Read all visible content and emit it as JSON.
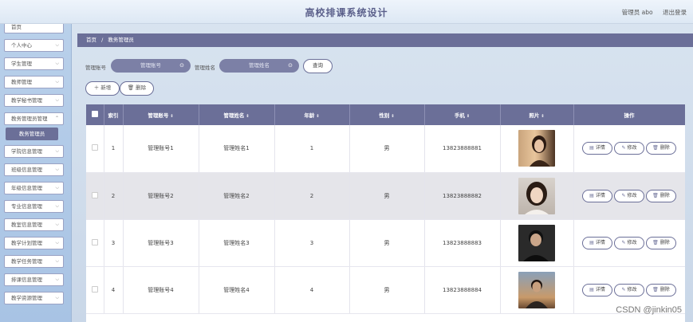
{
  "header": {
    "title": "高校排课系统设计",
    "user_label": "管理员 abo",
    "logout_label": "退出登录"
  },
  "sidebar": {
    "items": [
      {
        "label": "首页"
      },
      {
        "label": "个人中心"
      },
      {
        "label": "学生管理"
      },
      {
        "label": "教师管理"
      },
      {
        "label": "教学秘书管理"
      },
      {
        "label": "教务管理员管理"
      },
      {
        "label": "学院信息管理"
      },
      {
        "label": "班级信息管理"
      },
      {
        "label": "年级信息管理"
      },
      {
        "label": "专业信息管理"
      },
      {
        "label": "教室信息管理"
      },
      {
        "label": "教学计划管理"
      },
      {
        "label": "教学任务管理"
      },
      {
        "label": "排课信息管理"
      },
      {
        "label": "教学资源管理"
      }
    ],
    "active_sub": "教务管理员"
  },
  "breadcrumb": {
    "home": "首页",
    "sep": "/",
    "current": "教务管理员"
  },
  "search": {
    "account_label": "管理账号",
    "account_placeholder": "管理账号",
    "name_label": "管理姓名",
    "name_placeholder": "管理姓名",
    "query_label": "查询"
  },
  "actions": {
    "add_label": "新增",
    "delete_label": "删除"
  },
  "table": {
    "headers": {
      "index": "索引",
      "account": "管理账号",
      "name": "管理姓名",
      "age": "年龄",
      "gender": "性别",
      "phone": "手机",
      "photo": "照片",
      "ops": "操作"
    },
    "rows": [
      {
        "index": "1",
        "account": "管理账号1",
        "name": "管理姓名1",
        "age": "1",
        "gender": "男",
        "phone": "13823888881"
      },
      {
        "index": "2",
        "account": "管理账号2",
        "name": "管理姓名2",
        "age": "2",
        "gender": "男",
        "phone": "13823888882"
      },
      {
        "index": "3",
        "account": "管理账号3",
        "name": "管理姓名3",
        "age": "3",
        "gender": "男",
        "phone": "13823888883"
      },
      {
        "index": "4",
        "account": "管理账号4",
        "name": "管理姓名4",
        "age": "4",
        "gender": "男",
        "phone": "13823888884"
      }
    ],
    "op_labels": {
      "detail": "详情",
      "edit": "修改",
      "delete": "删除"
    }
  },
  "watermark": "CSDN @jinkin05",
  "colors": {
    "accent": "#6b6f98",
    "sidebar_bg": "#b9d0ea",
    "title": "#5a5f8a"
  }
}
